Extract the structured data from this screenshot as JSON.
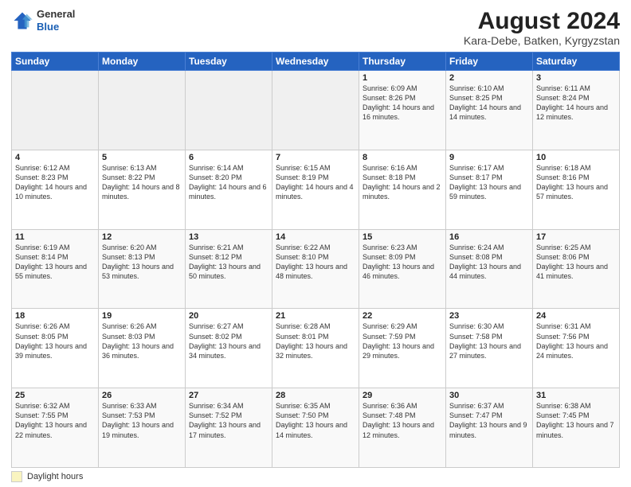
{
  "header": {
    "logo_line1": "General",
    "logo_line2": "Blue",
    "month_year": "August 2024",
    "location": "Kara-Debe, Batken, Kyrgyzstan"
  },
  "days_of_week": [
    "Sunday",
    "Monday",
    "Tuesday",
    "Wednesday",
    "Thursday",
    "Friday",
    "Saturday"
  ],
  "weeks": [
    [
      {
        "day": "",
        "info": ""
      },
      {
        "day": "",
        "info": ""
      },
      {
        "day": "",
        "info": ""
      },
      {
        "day": "",
        "info": ""
      },
      {
        "day": "1",
        "info": "Sunrise: 6:09 AM\nSunset: 8:26 PM\nDaylight: 14 hours and 16 minutes."
      },
      {
        "day": "2",
        "info": "Sunrise: 6:10 AM\nSunset: 8:25 PM\nDaylight: 14 hours and 14 minutes."
      },
      {
        "day": "3",
        "info": "Sunrise: 6:11 AM\nSunset: 8:24 PM\nDaylight: 14 hours and 12 minutes."
      }
    ],
    [
      {
        "day": "4",
        "info": "Sunrise: 6:12 AM\nSunset: 8:23 PM\nDaylight: 14 hours and 10 minutes."
      },
      {
        "day": "5",
        "info": "Sunrise: 6:13 AM\nSunset: 8:22 PM\nDaylight: 14 hours and 8 minutes."
      },
      {
        "day": "6",
        "info": "Sunrise: 6:14 AM\nSunset: 8:20 PM\nDaylight: 14 hours and 6 minutes."
      },
      {
        "day": "7",
        "info": "Sunrise: 6:15 AM\nSunset: 8:19 PM\nDaylight: 14 hours and 4 minutes."
      },
      {
        "day": "8",
        "info": "Sunrise: 6:16 AM\nSunset: 8:18 PM\nDaylight: 14 hours and 2 minutes."
      },
      {
        "day": "9",
        "info": "Sunrise: 6:17 AM\nSunset: 8:17 PM\nDaylight: 13 hours and 59 minutes."
      },
      {
        "day": "10",
        "info": "Sunrise: 6:18 AM\nSunset: 8:16 PM\nDaylight: 13 hours and 57 minutes."
      }
    ],
    [
      {
        "day": "11",
        "info": "Sunrise: 6:19 AM\nSunset: 8:14 PM\nDaylight: 13 hours and 55 minutes."
      },
      {
        "day": "12",
        "info": "Sunrise: 6:20 AM\nSunset: 8:13 PM\nDaylight: 13 hours and 53 minutes."
      },
      {
        "day": "13",
        "info": "Sunrise: 6:21 AM\nSunset: 8:12 PM\nDaylight: 13 hours and 50 minutes."
      },
      {
        "day": "14",
        "info": "Sunrise: 6:22 AM\nSunset: 8:10 PM\nDaylight: 13 hours and 48 minutes."
      },
      {
        "day": "15",
        "info": "Sunrise: 6:23 AM\nSunset: 8:09 PM\nDaylight: 13 hours and 46 minutes."
      },
      {
        "day": "16",
        "info": "Sunrise: 6:24 AM\nSunset: 8:08 PM\nDaylight: 13 hours and 44 minutes."
      },
      {
        "day": "17",
        "info": "Sunrise: 6:25 AM\nSunset: 8:06 PM\nDaylight: 13 hours and 41 minutes."
      }
    ],
    [
      {
        "day": "18",
        "info": "Sunrise: 6:26 AM\nSunset: 8:05 PM\nDaylight: 13 hours and 39 minutes."
      },
      {
        "day": "19",
        "info": "Sunrise: 6:26 AM\nSunset: 8:03 PM\nDaylight: 13 hours and 36 minutes."
      },
      {
        "day": "20",
        "info": "Sunrise: 6:27 AM\nSunset: 8:02 PM\nDaylight: 13 hours and 34 minutes."
      },
      {
        "day": "21",
        "info": "Sunrise: 6:28 AM\nSunset: 8:01 PM\nDaylight: 13 hours and 32 minutes."
      },
      {
        "day": "22",
        "info": "Sunrise: 6:29 AM\nSunset: 7:59 PM\nDaylight: 13 hours and 29 minutes."
      },
      {
        "day": "23",
        "info": "Sunrise: 6:30 AM\nSunset: 7:58 PM\nDaylight: 13 hours and 27 minutes."
      },
      {
        "day": "24",
        "info": "Sunrise: 6:31 AM\nSunset: 7:56 PM\nDaylight: 13 hours and 24 minutes."
      }
    ],
    [
      {
        "day": "25",
        "info": "Sunrise: 6:32 AM\nSunset: 7:55 PM\nDaylight: 13 hours and 22 minutes."
      },
      {
        "day": "26",
        "info": "Sunrise: 6:33 AM\nSunset: 7:53 PM\nDaylight: 13 hours and 19 minutes."
      },
      {
        "day": "27",
        "info": "Sunrise: 6:34 AM\nSunset: 7:52 PM\nDaylight: 13 hours and 17 minutes."
      },
      {
        "day": "28",
        "info": "Sunrise: 6:35 AM\nSunset: 7:50 PM\nDaylight: 13 hours and 14 minutes."
      },
      {
        "day": "29",
        "info": "Sunrise: 6:36 AM\nSunset: 7:48 PM\nDaylight: 13 hours and 12 minutes."
      },
      {
        "day": "30",
        "info": "Sunrise: 6:37 AM\nSunset: 7:47 PM\nDaylight: 13 hours and 9 minutes."
      },
      {
        "day": "31",
        "info": "Sunrise: 6:38 AM\nSunset: 7:45 PM\nDaylight: 13 hours and 7 minutes."
      }
    ]
  ],
  "footer": {
    "legend_label": "Daylight hours"
  }
}
